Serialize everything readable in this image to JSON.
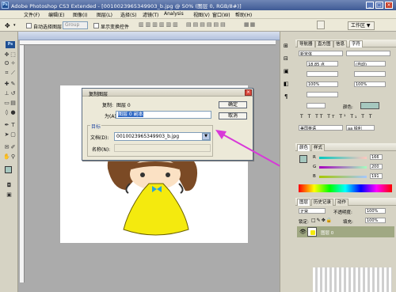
{
  "window": {
    "title": "Adobe Photoshop CS3 Extended - [0010023965349903_b.jpg @ 50% (图层 0, RGB/8#)]",
    "buttons": [
      "_",
      "□",
      "×"
    ]
  },
  "menu": [
    "文件(F)",
    "编辑(E)",
    "图像(I)",
    "图层(L)",
    "选择(S)",
    "滤镜(T)",
    "Analysis",
    "视图(V)",
    "窗口(W)",
    "帮助(H)"
  ],
  "options": {
    "auto_select_label": "自动选择图层",
    "auto_select_value": "Group",
    "show_transform_label": "显示变换控件",
    "workspace_label": "工作区 ▼"
  },
  "dialog": {
    "title": "复制图层",
    "copy_label": "复制:",
    "copy_value": "图层 0",
    "as_label": "为(A):",
    "as_value": "图层 0 副本",
    "group_label": "目标",
    "doc_label": "文档(D):",
    "doc_value": "0010023965349903_b.jpg",
    "name_label": "名称(N):",
    "ok": "确定",
    "cancel": "取消"
  },
  "panels": {
    "top_tabs": [
      "导航器",
      "直方图",
      "信息",
      "字符"
    ],
    "char_font": "新宋体",
    "char_size": "18.85 点",
    "char_lead": "(自动)",
    "char_scale": "100%",
    "char_color_label": "颜色:",
    "char_lang": "美国英语",
    "char_aa": "aa 锐利",
    "color_tabs": [
      "颜色",
      "样式"
    ],
    "color_values": [
      "166",
      "200",
      "191"
    ],
    "layers_tabs": [
      "图层",
      "历史记录",
      "动作"
    ],
    "blend_mode": "正常",
    "opacity_label": "不透明度:",
    "opacity_value": "100%",
    "lock_label": "锁定:",
    "fill_label": "填充:",
    "fill_value": "100%",
    "layer_name": "图层 0"
  },
  "colors": {
    "accent": "#3f5a95",
    "swatch": "#a6c8bf",
    "arrow": "#d838d8"
  }
}
